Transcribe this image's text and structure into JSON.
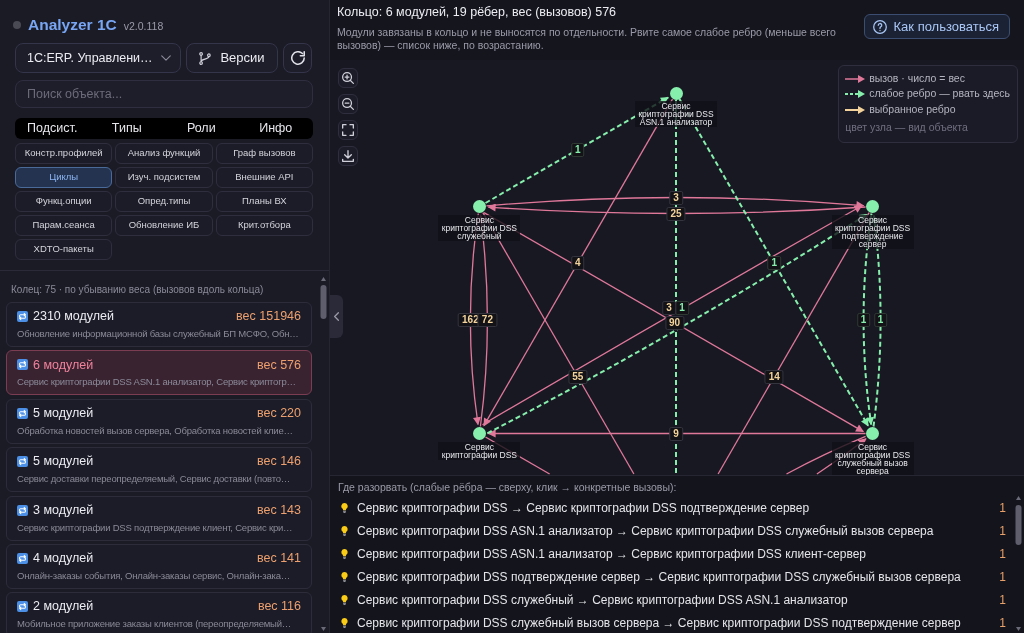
{
  "app": {
    "title": "Analyzer 1C",
    "version": "v2.0.118"
  },
  "configuration_select": {
    "value": "1C:ERP. Управлени…"
  },
  "versions_button": {
    "label": "Версии"
  },
  "search": {
    "placeholder": "Поиск объекта..."
  },
  "tabs": [
    {
      "label": "Подсист.",
      "selected": false
    },
    {
      "label": "Типы",
      "selected": false
    },
    {
      "label": "Роли",
      "selected": false
    },
    {
      "label": "Инфо",
      "selected": false
    }
  ],
  "tools": [
    {
      "label": "Констр.профилей",
      "selected": false
    },
    {
      "label": "Анализ функций",
      "selected": false
    },
    {
      "label": "Граф вызовов",
      "selected": false
    },
    {
      "label": "Циклы",
      "selected": true
    },
    {
      "label": "Изуч. подсистем",
      "selected": false
    },
    {
      "label": "Внешние API",
      "selected": false
    },
    {
      "label": "Функц.опции",
      "selected": false
    },
    {
      "label": "Опред.типы",
      "selected": false
    },
    {
      "label": "Планы ВХ",
      "selected": false
    },
    {
      "label": "Парам.сеанса",
      "selected": false
    },
    {
      "label": "Обновление ИБ",
      "selected": false
    },
    {
      "label": "Крит.отбора",
      "selected": false
    },
    {
      "label": "XDTO-пакеты",
      "selected": false
    }
  ],
  "cycles": {
    "summary": "Колец: 75 · по убыванию веса (вызовов вдоль кольца)",
    "items": [
      {
        "title": "2310 модулей",
        "weight": "вес 151946",
        "modules": "Обновление информационной базы служебный БП МСФО, Обн…",
        "selected": false
      },
      {
        "title": "6 модулей",
        "weight": "вес 576",
        "modules": "Сервис криптографии DSS ASN.1 анализатор, Сервис криптогр…",
        "selected": true
      },
      {
        "title": "5 модулей",
        "weight": "вес 220",
        "modules": "Обработка новостей вызов сервера, Обработка новостей клие…",
        "selected": false
      },
      {
        "title": "5 модулей",
        "weight": "вес 146",
        "modules": "Сервис доставки переопределяемый, Сервис доставки (повто…",
        "selected": false
      },
      {
        "title": "3 модулей",
        "weight": "вес 143",
        "modules": "Сервис криптографии DSS подтверждение клиент, Сервис кри…",
        "selected": false
      },
      {
        "title": "4 модулей",
        "weight": "вес 141",
        "modules": "Онлайн-заказы события, Онлайн-заказы сервис, Онлайн-зака…",
        "selected": false
      },
      {
        "title": "2 модулей",
        "weight": "вес 116",
        "modules": "Мобильное приложение заказы клиентов (переопределяемый…",
        "selected": false
      }
    ]
  },
  "ring_header": {
    "title": "Кольцо: 6 модулей, 19 рёбер, вес (вызовов) 576",
    "description": "Модули завязаны в кольцо и не выносятся по отдельности. Рвите самое слабое ребро (меньше всего вызовов) — список ниже, по возрастанию.",
    "help_button": "Как пользоваться"
  },
  "graph": {
    "legend": [
      {
        "kind": "call",
        "label": "вызов · число = вес"
      },
      {
        "kind": "weak",
        "label": "слабое ребро — рвать здесь"
      },
      {
        "kind": "selected",
        "label": "выбранное ребро"
      },
      {
        "kind": "note",
        "label": "цвет узла — вид объекта"
      }
    ],
    "nodes": [
      {
        "label": "Сервис криптографии DSS ASN.1 анализатор",
        "color": "#86efac"
      },
      {
        "label": "Сервис криптографии DSS служебный",
        "color": "#86efac"
      },
      {
        "label": "Сервис криптографии DSS подтверждение сервер",
        "color": "#86efac"
      },
      {
        "label": "Сервис криптографии DSS",
        "color": "#86efac"
      },
      {
        "label": "Сервис криптографии DSS служебный вызов сервера",
        "color": "#86efac"
      }
    ],
    "edges": [
      {
        "kind": "weak",
        "label": "1"
      },
      {
        "kind": "call",
        "label": "3"
      },
      {
        "kind": "call",
        "label": "25"
      },
      {
        "kind": "call",
        "label": "4"
      },
      {
        "kind": "weak",
        "label": "1"
      },
      {
        "kind": "call",
        "label": "3"
      },
      {
        "kind": "weak",
        "label": "1"
      },
      {
        "kind": "call",
        "label": "162"
      },
      {
        "kind": "call",
        "label": "72"
      },
      {
        "kind": "call",
        "label": "90"
      },
      {
        "kind": "weak",
        "label": "1"
      },
      {
        "kind": "weak",
        "label": "1"
      },
      {
        "kind": "call",
        "label": "55"
      },
      {
        "kind": "call",
        "label": "14"
      },
      {
        "kind": "call",
        "label": "9"
      },
      {
        "kind": "weak"
      },
      {
        "kind": "call"
      },
      {
        "kind": "call"
      },
      {
        "kind": "call"
      }
    ]
  },
  "break_list": {
    "heading": "Где разорвать (слабые рёбра — сверху, клик → конкретные вызовы):",
    "items": [
      {
        "text": "Сервис криптографии DSS → Сервис криптографии DSS подтверждение сервер",
        "count": "1"
      },
      {
        "text": "Сервис криптографии DSS ASN.1 анализатор → Сервис криптографии DSS служебный вызов сервера",
        "count": "1"
      },
      {
        "text": "Сервис криптографии DSS ASN.1 анализатор → Сервис криптографии DSS клиент-сервер",
        "count": "1"
      },
      {
        "text": "Сервис криптографии DSS подтверждение сервер → Сервис криптографии DSS служебный вызов сервера",
        "count": "1"
      },
      {
        "text": "Сервис криптографии DSS служебный → Сервис криптографии DSS ASN.1 анализатор",
        "count": "1"
      },
      {
        "text": "Сервис криптографии DSS служебный вызов сервера → Сервис криптографии DSS подтверждение сервер",
        "count": "1"
      }
    ]
  }
}
